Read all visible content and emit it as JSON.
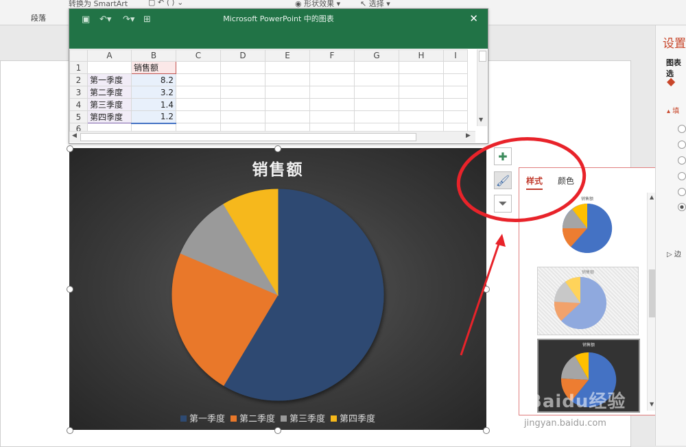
{
  "ribbon": {
    "paragraph_label": "段落",
    "smartart_label": "转换为 SmartArt",
    "shape_effects_label": "形状效果",
    "select_label": "选择"
  },
  "excel": {
    "title": "Microsoft PowerPoint 中的图表",
    "column_headers": [
      "A",
      "B",
      "C",
      "D",
      "E",
      "F",
      "G",
      "H",
      "I"
    ],
    "rows": [
      {
        "num": "1",
        "a": "",
        "b": "销售额"
      },
      {
        "num": "2",
        "a": "第一季度",
        "b": "8.2"
      },
      {
        "num": "3",
        "a": "第二季度",
        "b": "3.2"
      },
      {
        "num": "4",
        "a": "第三季度",
        "b": "1.4"
      },
      {
        "num": "5",
        "a": "第四季度",
        "b": "1.2"
      },
      {
        "num": "6",
        "a": "",
        "b": ""
      }
    ]
  },
  "chart_data": {
    "type": "pie",
    "title": "销售额",
    "categories": [
      "第一季度",
      "第二季度",
      "第三季度",
      "第四季度"
    ],
    "values": [
      8.2,
      3.2,
      1.4,
      1.2
    ],
    "colors": [
      "#2e4a72",
      "#e9782a",
      "#9a9a9a",
      "#f6b81a"
    ],
    "legend_position": "bottom"
  },
  "chart_buttons": {
    "add_icon": "plus-icon",
    "style_icon": "paintbrush-icon",
    "filter_icon": "filter-icon"
  },
  "style_pane": {
    "tab_style": "样式",
    "tab_color": "颜色",
    "thumb_title": "销售额",
    "selected_thumb": 3
  },
  "right_panel": {
    "title": "设置",
    "subtitle": "图表选",
    "fill_label": "填",
    "border_label": "边"
  },
  "watermark": {
    "logo": "Baidu经验",
    "url": "jingyan.baidu.com"
  },
  "accent_colors": {
    "excel_green": "#217346",
    "annotation_red": "#e8232a"
  }
}
